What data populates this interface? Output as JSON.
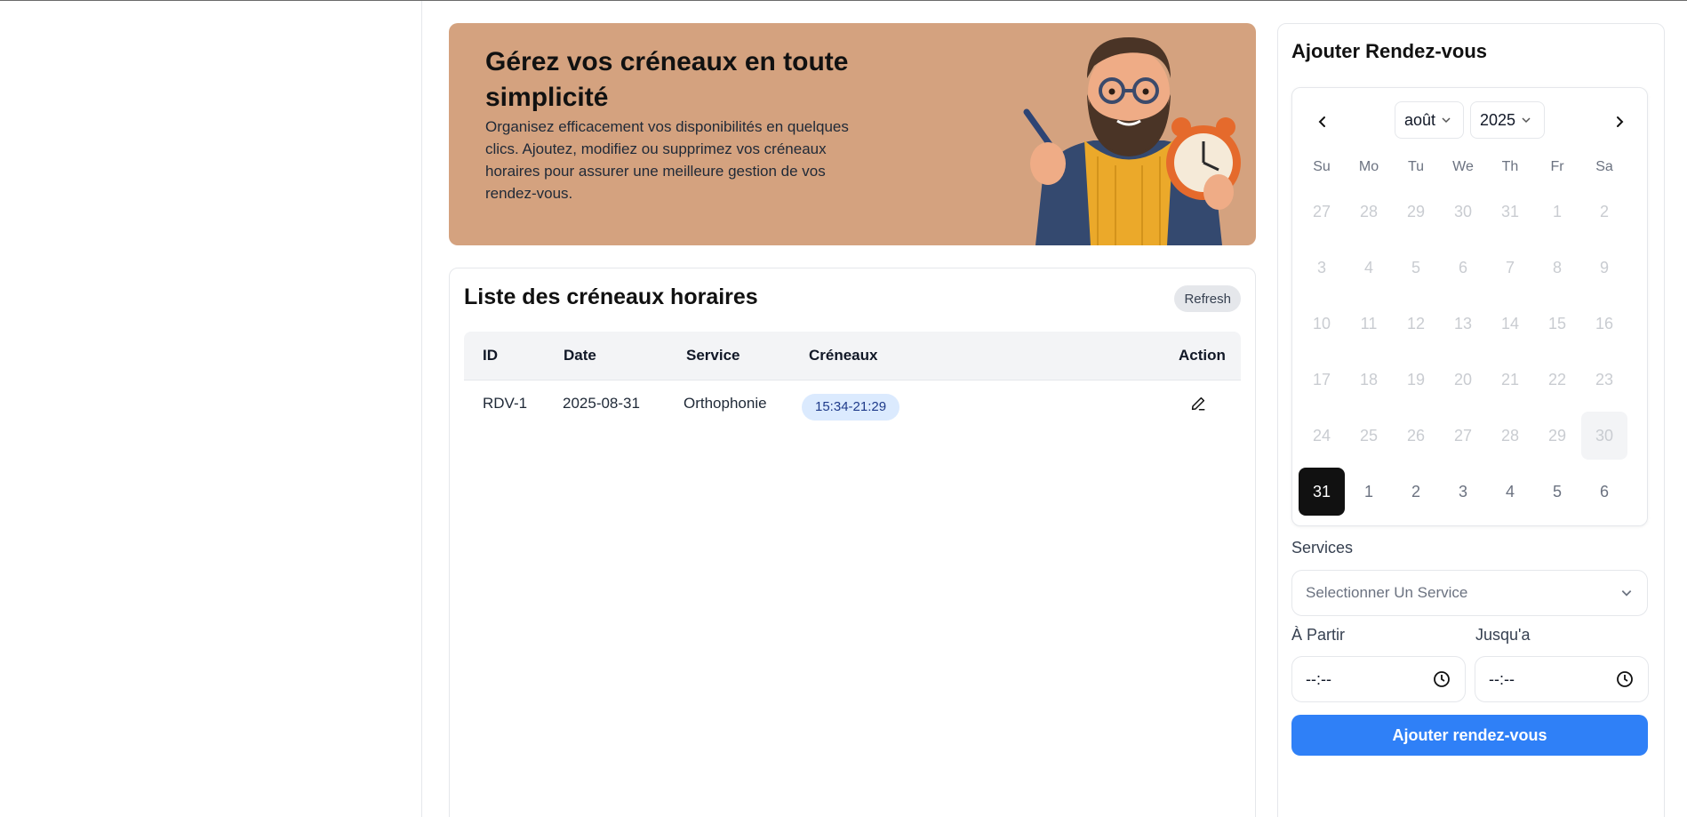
{
  "banner": {
    "title": "Gérez vos créneaux en toute simplicité",
    "description": "Organisez efficacement vos disponibilités en quelques clics. Ajoutez, modifiez ou supprimez vos créneaux horaires pour assurer une meilleure gestion de vos rendez-vous.",
    "bg_color": "#d4a27f"
  },
  "slots": {
    "title": "Liste des créneaux horaires",
    "refresh_label": "Refresh",
    "columns": [
      "ID",
      "Date",
      "Service",
      "Créneaux",
      "Action"
    ],
    "rows": [
      {
        "id": "RDV-1",
        "date": "2025-08-31",
        "service": "Orthophonie",
        "slot": "15:34-21:29",
        "action_icon": "pencil-icon"
      }
    ]
  },
  "appointment": {
    "title": "Ajouter Rendez-vous",
    "calendar": {
      "month": "août",
      "year": "2025",
      "weekdays": [
        "Su",
        "Mo",
        "Tu",
        "We",
        "Th",
        "Fr",
        "Sa"
      ],
      "weeks": [
        [
          "27",
          "28",
          "29",
          "30",
          "31",
          "1",
          "2"
        ],
        [
          "3",
          "4",
          "5",
          "6",
          "7",
          "8",
          "9"
        ],
        [
          "10",
          "11",
          "12",
          "13",
          "14",
          "15",
          "16"
        ],
        [
          "17",
          "18",
          "19",
          "20",
          "21",
          "22",
          "23"
        ],
        [
          "24",
          "25",
          "26",
          "27",
          "28",
          "29",
          "30"
        ],
        [
          "31",
          "1",
          "2",
          "3",
          "4",
          "5",
          "6"
        ]
      ],
      "selected_day": "31",
      "highlighted_day": "30"
    },
    "services_label": "Services",
    "services_placeholder": "Selectionner Un Service",
    "from_label": "À Partir",
    "to_label": "Jusqu'a",
    "from_value": "--:--",
    "to_value": "--:--",
    "submit_label": "Ajouter rendez-vous",
    "accent_color": "#2f80f7"
  }
}
